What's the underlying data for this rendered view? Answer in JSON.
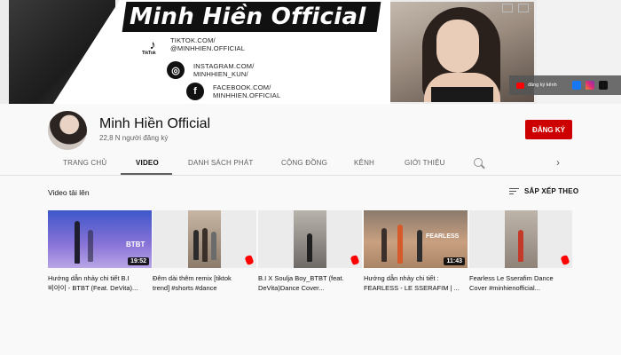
{
  "banner": {
    "title": "Minh Hiền Official",
    "socials": [
      {
        "icon": "tiktok-icon",
        "line1": "TIKTOK.COM/",
        "line2": "@MINHHIEN.OFFICIAL"
      },
      {
        "icon": "instagram-icon",
        "line1": "INSTAGRAM.COM/",
        "line2": "MINHHIEN_KUN/"
      },
      {
        "icon": "facebook-icon",
        "line1": "FACEBOOK.COM/",
        "line2": "MINHHIEN.OFFICIAL"
      }
    ],
    "tiktok_caption": "TikTok",
    "subscribe_link": "đăng ký kênh"
  },
  "channel": {
    "name": "Minh Hiền Official",
    "subscribers": "22,8 N người đăng ký",
    "subscribe_button": "ĐĂNG KÝ"
  },
  "tabs": [
    "TRANG CHỦ",
    "VIDEO",
    "DANH SÁCH PHÁT",
    "CỘNG ĐỒNG",
    "KÊNH",
    "GIỚI THIỆU"
  ],
  "active_tab": "VIDEO",
  "section": {
    "title": "Video tải lên",
    "sort_label": "SẮP XẾP THEO"
  },
  "videos": [
    {
      "line1": "Hướng dẫn nhảy chi tiết B.I",
      "line2": "비아이 - BTBT (Feat. DeVita)...",
      "duration": "19:52",
      "short": false
    },
    {
      "line1": "Đêm dài thêm remix [tiktok",
      "line2": "trend] #shorts #dance",
      "duration": "",
      "short": true
    },
    {
      "line1": "B.I X Soulja Boy_BTBT (feat.",
      "line2": "DeVita)Dance Cover...",
      "duration": "",
      "short": true
    },
    {
      "line1": "Hướng dẫn nhảy chi tiết :",
      "line2": "FEARLESS - LE SSERAFIM | ...",
      "duration": "11:43",
      "short": false
    },
    {
      "line1": "Fearless Le Sserafim Dance",
      "line2": "Cover #minhienofficial...",
      "duration": "",
      "short": true
    }
  ],
  "colors": {
    "subscribe_red": "#cc0000",
    "shorts_red": "#ff0000",
    "text_primary": "#0f0f0f",
    "text_secondary": "#606060"
  }
}
